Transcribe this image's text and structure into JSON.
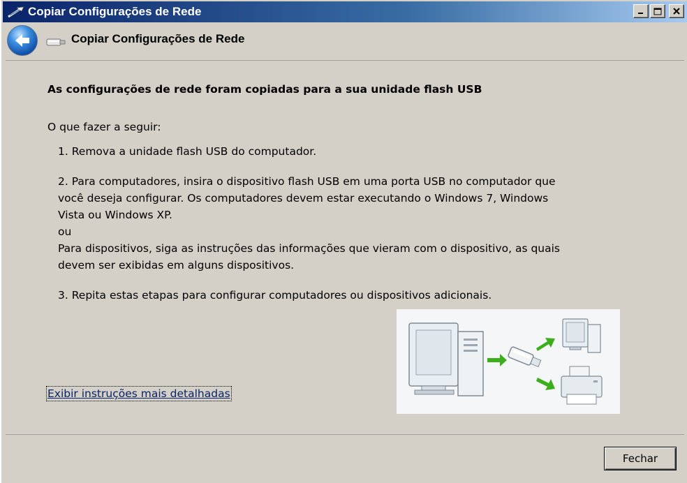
{
  "window": {
    "title": "Copiar Configurações de Rede"
  },
  "nav": {
    "title": "Copiar Configurações de Rede"
  },
  "content": {
    "heading": "As configurações de rede foram copiadas para a sua unidade flash USB",
    "intro": "O que fazer a seguir:",
    "step1": "1. Remova a unidade flash USB do computador.",
    "step2_line1": "2. Para computadores, insira o dispositivo flash USB em uma porta USB no computador que",
    "step2_line2": "você deseja configurar. Os computadores devem estar executando o Windows 7, Windows",
    "step2_line3": "Vista ou Windows XP.",
    "step2_or": "ou",
    "step2_line4": "Para dispositivos, siga as instruções das informações que vieram com o dispositivo, as quais",
    "step2_line5": "devem ser exibidas em alguns dispositivos.",
    "step3": "3. Repita estas etapas para configurar computadores ou dispositivos adicionais.",
    "details_link": "Exibir instruções mais detalhadas"
  },
  "footer": {
    "close_label": "Fechar"
  },
  "icons": {
    "window": "network-wand-icon",
    "back": "back-arrow-icon",
    "nav": "usb-drive-icon"
  },
  "colors": {
    "titlebar_start": "#0a246a",
    "titlebar_end": "#a6caf0",
    "link": "#0a246a",
    "arrow_green": "#3cae1c"
  }
}
